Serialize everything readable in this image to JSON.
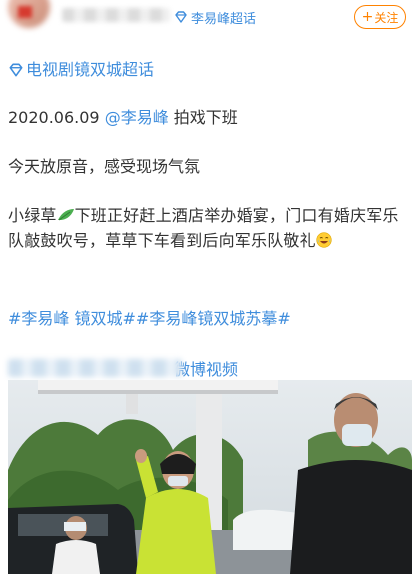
{
  "header": {
    "super_topic": "李易峰超话",
    "follow_label": "关注",
    "follow_icon": "plus-icon",
    "accent_color": "#ff8200",
    "link_color": "#3f8ddc"
  },
  "post": {
    "topic_link": "电视剧镜双城超话",
    "date": "2020.06.09 ",
    "mention": "@李易峰",
    "date_suffix": " 拍戏下班",
    "line3": "今天放原音，感受现场气氛",
    "para_part1": "小绿草",
    "leaf_icon": "leaf-emoji-icon",
    "para_part2": "下班正好赶上酒店举办婚宴，门口有婚庆军乐队敲鼓吹号，草草下车看到后向军乐队敬礼",
    "laugh_icon": "laughing-emoji-icon",
    "hashtag1": "#李易峰 镜双城#",
    "hashtag2": "#李易峰镜双城苏摹#",
    "video_label": "微博视频"
  }
}
